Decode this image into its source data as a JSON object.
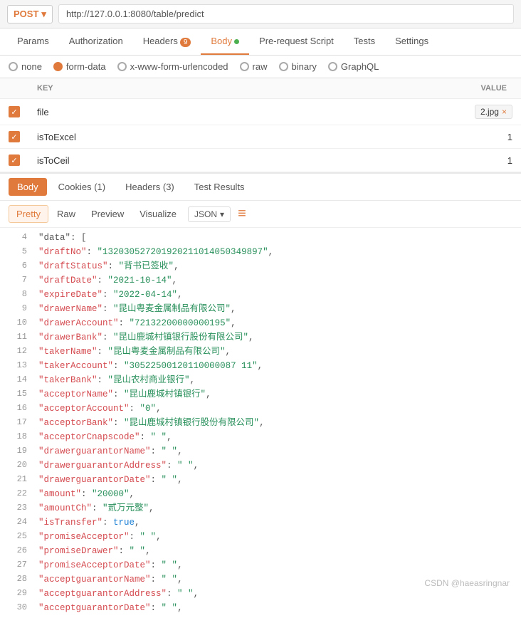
{
  "topbar": {
    "method": "POST",
    "url": "http://127.0.0.1:8080/table/predict"
  },
  "nav_tabs": [
    {
      "label": "Params",
      "active": false,
      "badge": null,
      "dot": false
    },
    {
      "label": "Authorization",
      "active": false,
      "badge": null,
      "dot": false
    },
    {
      "label": "Headers",
      "active": false,
      "badge": "9",
      "dot": false
    },
    {
      "label": "Body",
      "active": true,
      "badge": null,
      "dot": true
    },
    {
      "label": "Pre-request Script",
      "active": false,
      "badge": null,
      "dot": false
    },
    {
      "label": "Tests",
      "active": false,
      "badge": null,
      "dot": false
    },
    {
      "label": "Settings",
      "active": false,
      "badge": null,
      "dot": false
    }
  ],
  "body_types": [
    {
      "label": "none",
      "selected": false
    },
    {
      "label": "form-data",
      "selected": true
    },
    {
      "label": "x-www-form-urlencoded",
      "selected": false
    },
    {
      "label": "raw",
      "selected": false
    },
    {
      "label": "binary",
      "selected": false
    },
    {
      "label": "GraphQL",
      "selected": false
    }
  ],
  "form_table": {
    "col_key": "KEY",
    "col_value": "VALUE",
    "rows": [
      {
        "checked": true,
        "key": "file",
        "value": "2.jpg",
        "is_file": true
      },
      {
        "checked": true,
        "key": "isToExcel",
        "value": "1",
        "is_file": false
      },
      {
        "checked": true,
        "key": "isToCeil",
        "value": "1",
        "is_file": false
      }
    ]
  },
  "response_section": {
    "tabs": [
      {
        "label": "Body",
        "active": true
      },
      {
        "label": "Cookies (1)",
        "active": false
      },
      {
        "label": "Headers (3)",
        "active": false
      },
      {
        "label": "Test Results",
        "active": false
      }
    ],
    "format_tabs": [
      {
        "label": "Pretty",
        "active": true
      },
      {
        "label": "Raw",
        "active": false
      },
      {
        "label": "Preview",
        "active": false
      },
      {
        "label": "Visualize",
        "active": false
      }
    ],
    "format_dropdown": "JSON"
  },
  "code_lines": [
    {
      "num": 4,
      "content": [
        {
          "t": "punct",
          "v": "    \"data\": ["
        }
      ]
    },
    {
      "num": 5,
      "content": [
        {
          "t": "key",
          "v": "        \"draftNo\""
        },
        {
          "t": "punct",
          "v": ": "
        },
        {
          "t": "str",
          "v": "\"132030527201920211014050349897\""
        },
        {
          "t": "punct",
          "v": ","
        }
      ]
    },
    {
      "num": 6,
      "content": [
        {
          "t": "key",
          "v": "        \"draftStatus\""
        },
        {
          "t": "punct",
          "v": ": "
        },
        {
          "t": "str",
          "v": "\"背书已签收\""
        },
        {
          "t": "punct",
          "v": ","
        }
      ]
    },
    {
      "num": 7,
      "content": [
        {
          "t": "key",
          "v": "        \"draftDate\""
        },
        {
          "t": "punct",
          "v": ": "
        },
        {
          "t": "str",
          "v": "\"2021-10-14\""
        },
        {
          "t": "punct",
          "v": ","
        }
      ]
    },
    {
      "num": 8,
      "content": [
        {
          "t": "key",
          "v": "        \"expireDate\""
        },
        {
          "t": "punct",
          "v": ": "
        },
        {
          "t": "str",
          "v": "\"2022-04-14\""
        },
        {
          "t": "punct",
          "v": ","
        }
      ]
    },
    {
      "num": 9,
      "content": [
        {
          "t": "key",
          "v": "        \"drawerName\""
        },
        {
          "t": "punct",
          "v": ": "
        },
        {
          "t": "str",
          "v": "\"昆山粤麦金属制品有限公司\""
        },
        {
          "t": "punct",
          "v": ","
        }
      ]
    },
    {
      "num": 10,
      "content": [
        {
          "t": "key",
          "v": "        \"drawerAccount\""
        },
        {
          "t": "punct",
          "v": ": "
        },
        {
          "t": "str",
          "v": "\"72132200000000195\""
        },
        {
          "t": "punct",
          "v": ","
        }
      ]
    },
    {
      "num": 11,
      "content": [
        {
          "t": "key",
          "v": "        \"drawerBank\""
        },
        {
          "t": "punct",
          "v": ": "
        },
        {
          "t": "str",
          "v": "\"昆山鹿城村镇银行股份有限公司\""
        },
        {
          "t": "punct",
          "v": ","
        }
      ]
    },
    {
      "num": 12,
      "content": [
        {
          "t": "key",
          "v": "        \"takerName\""
        },
        {
          "t": "punct",
          "v": ": "
        },
        {
          "t": "str",
          "v": "\"昆山粤麦金属制品有限公司\""
        },
        {
          "t": "punct",
          "v": ","
        }
      ]
    },
    {
      "num": 13,
      "content": [
        {
          "t": "key",
          "v": "        \"takerAccount\""
        },
        {
          "t": "punct",
          "v": ": "
        },
        {
          "t": "str",
          "v": "\"30522500120110000087 11\""
        },
        {
          "t": "punct",
          "v": ","
        }
      ]
    },
    {
      "num": 14,
      "content": [
        {
          "t": "key",
          "v": "        \"takerBank\""
        },
        {
          "t": "punct",
          "v": ": "
        },
        {
          "t": "str",
          "v": "\"昆山农村商业银行\""
        },
        {
          "t": "punct",
          "v": ","
        }
      ]
    },
    {
      "num": 15,
      "content": [
        {
          "t": "key",
          "v": "        \"acceptorName\""
        },
        {
          "t": "punct",
          "v": ": "
        },
        {
          "t": "str",
          "v": "\"昆山鹿城村镇银行\""
        },
        {
          "t": "punct",
          "v": ","
        }
      ]
    },
    {
      "num": 16,
      "content": [
        {
          "t": "key",
          "v": "        \"acceptorAccount\""
        },
        {
          "t": "punct",
          "v": ": "
        },
        {
          "t": "str",
          "v": "\"0\""
        },
        {
          "t": "punct",
          "v": ","
        }
      ]
    },
    {
      "num": 17,
      "content": [
        {
          "t": "key",
          "v": "        \"acceptorBank\""
        },
        {
          "t": "punct",
          "v": ": "
        },
        {
          "t": "str",
          "v": "\"昆山鹿城村镇银行股份有限公司\""
        },
        {
          "t": "punct",
          "v": ","
        }
      ]
    },
    {
      "num": 18,
      "content": [
        {
          "t": "key",
          "v": "        \"acceptorCnapscode\""
        },
        {
          "t": "punct",
          "v": ": "
        },
        {
          "t": "str",
          "v": "\" \""
        },
        {
          "t": "punct",
          "v": ","
        }
      ]
    },
    {
      "num": 19,
      "content": [
        {
          "t": "key",
          "v": "        \"drawerguarantorName\""
        },
        {
          "t": "punct",
          "v": ": "
        },
        {
          "t": "str",
          "v": "\" \""
        },
        {
          "t": "punct",
          "v": ","
        }
      ]
    },
    {
      "num": 20,
      "content": [
        {
          "t": "key",
          "v": "        \"drawerguarantorAddress\""
        },
        {
          "t": "punct",
          "v": ": "
        },
        {
          "t": "str",
          "v": "\" \""
        },
        {
          "t": "punct",
          "v": ","
        }
      ]
    },
    {
      "num": 21,
      "content": [
        {
          "t": "key",
          "v": "        \"drawerguarantorDate\""
        },
        {
          "t": "punct",
          "v": ": "
        },
        {
          "t": "str",
          "v": "\" \""
        },
        {
          "t": "punct",
          "v": ","
        }
      ]
    },
    {
      "num": 22,
      "content": [
        {
          "t": "key",
          "v": "        \"amount\""
        },
        {
          "t": "punct",
          "v": ": "
        },
        {
          "t": "str",
          "v": "\"20000\""
        },
        {
          "t": "punct",
          "v": ","
        }
      ]
    },
    {
      "num": 23,
      "content": [
        {
          "t": "key",
          "v": "        \"amountCh\""
        },
        {
          "t": "punct",
          "v": ": "
        },
        {
          "t": "str",
          "v": "\"贰万元整\""
        },
        {
          "t": "punct",
          "v": ","
        }
      ]
    },
    {
      "num": 24,
      "content": [
        {
          "t": "key",
          "v": "        \"isTransfer\""
        },
        {
          "t": "punct",
          "v": ": "
        },
        {
          "t": "bool",
          "v": "true"
        },
        {
          "t": "punct",
          "v": ","
        }
      ]
    },
    {
      "num": 25,
      "content": [
        {
          "t": "key",
          "v": "        \"promiseAcceptor\""
        },
        {
          "t": "punct",
          "v": ": "
        },
        {
          "t": "str",
          "v": "\" \""
        },
        {
          "t": "punct",
          "v": ","
        }
      ]
    },
    {
      "num": 26,
      "content": [
        {
          "t": "key",
          "v": "        \"promiseDrawer\""
        },
        {
          "t": "punct",
          "v": ": "
        },
        {
          "t": "str",
          "v": "\" \""
        },
        {
          "t": "punct",
          "v": ","
        }
      ]
    },
    {
      "num": 27,
      "content": [
        {
          "t": "key",
          "v": "        \"promiseAcceptorDate\""
        },
        {
          "t": "punct",
          "v": ": "
        },
        {
          "t": "str",
          "v": "\" \""
        },
        {
          "t": "punct",
          "v": ","
        }
      ]
    },
    {
      "num": 28,
      "content": [
        {
          "t": "key",
          "v": "        \"acceptguarantorName\""
        },
        {
          "t": "punct",
          "v": ": "
        },
        {
          "t": "str",
          "v": "\" \""
        },
        {
          "t": "punct",
          "v": ","
        }
      ]
    },
    {
      "num": 29,
      "content": [
        {
          "t": "key",
          "v": "        \"acceptguarantorAddress\""
        },
        {
          "t": "punct",
          "v": ": "
        },
        {
          "t": "str",
          "v": "\" \""
        },
        {
          "t": "punct",
          "v": ","
        }
      ]
    },
    {
      "num": 30,
      "content": [
        {
          "t": "key",
          "v": "        \"acceptguarantorDate\""
        },
        {
          "t": "punct",
          "v": ": "
        },
        {
          "t": "str",
          "v": "\" \""
        },
        {
          "t": "punct",
          "v": ","
        }
      ]
    }
  ],
  "watermark": "CSDN @haeasringnar"
}
